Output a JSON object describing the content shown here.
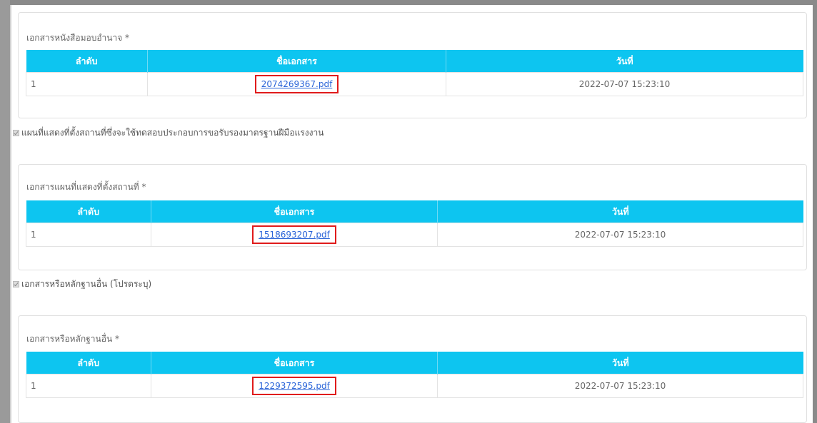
{
  "sections": [
    {
      "title": "เอกสารหนังสือมอบอำนาจ *",
      "headers": [
        "ลำดับ",
        "ชื่อเอกสาร",
        "วันที่"
      ],
      "rows": [
        {
          "no": "1",
          "file": "2074269367.pdf",
          "date": "2022-07-07 15:23:10"
        }
      ]
    },
    {
      "title": "เอกสารแผนที่แสดงที่ตั้งสถานที่ *",
      "headers": [
        "ลำดับ",
        "ชื่อเอกสาร",
        "วันที่"
      ],
      "rows": [
        {
          "no": "1",
          "file": "1518693207.pdf",
          "date": "2022-07-07 15:23:10"
        }
      ]
    },
    {
      "title": "เอกสารหรือหลักฐานอื่น *",
      "headers": [
        "ลำดับ",
        "ชื่อเอกสาร",
        "วันที่"
      ],
      "rows": [
        {
          "no": "1",
          "file": "1229372595.pdf",
          "date": "2022-07-07 15:23:10"
        }
      ]
    }
  ],
  "checkboxes": [
    {
      "label": "แผนที่แสดงที่ตั้งสถานที่ซึ่งจะใช้ทดสอบประกอบการขอรับรองมาตรฐานฝีมือแรงงาน",
      "checked": true
    },
    {
      "label": "เอกสารหรือหลักฐานอื่น (โปรดระบุ)",
      "checked": true
    }
  ],
  "colors": {
    "header_bg": "#0dc5f0",
    "link": "#2a64d8",
    "highlight_box": "#e01b1b"
  }
}
